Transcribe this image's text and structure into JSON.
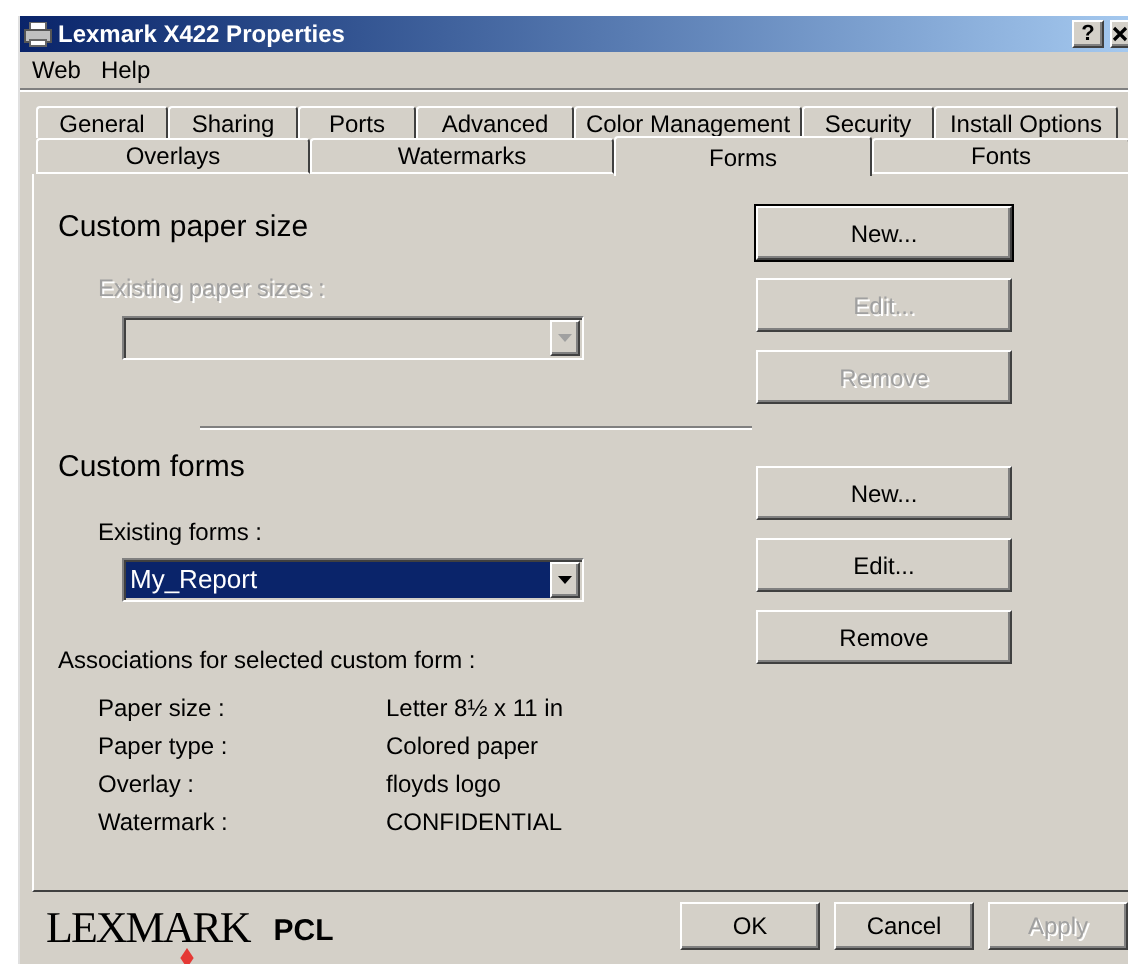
{
  "window": {
    "title": "Lexmark X422 Properties",
    "help_button": "?"
  },
  "menu": [
    {
      "label": "Web"
    },
    {
      "label": "Help"
    }
  ],
  "tabs_row1": [
    {
      "label": "General",
      "selected": false
    },
    {
      "label": "Sharing",
      "selected": false
    },
    {
      "label": "Ports",
      "selected": false
    },
    {
      "label": "Advanced",
      "selected": false
    },
    {
      "label": "Color Management",
      "selected": false
    },
    {
      "label": "Security",
      "selected": false
    },
    {
      "label": "Install Options",
      "selected": false
    }
  ],
  "tabs_row2": [
    {
      "label": "Overlays",
      "selected": false
    },
    {
      "label": "Watermarks",
      "selected": false
    },
    {
      "label": "Forms",
      "selected": true
    },
    {
      "label": "Fonts",
      "selected": false
    }
  ],
  "custom_paper_size": {
    "heading": "Custom paper size",
    "existing_label": "Existing paper sizes :",
    "disabled": true,
    "buttons": [
      {
        "label": "New...",
        "disabled": false,
        "default": true
      },
      {
        "label": "Edit...",
        "disabled": true,
        "default": false
      },
      {
        "label": "Remove",
        "disabled": true,
        "default": false
      }
    ]
  },
  "custom_forms": {
    "heading": "Custom forms",
    "existing_label": "Existing forms :",
    "disabled": false,
    "combo": {
      "value": "My_Report",
      "selected": true
    },
    "buttons": [
      {
        "label": "New...",
        "disabled": false,
        "default": false
      },
      {
        "label": "Edit...",
        "disabled": false,
        "default": false
      },
      {
        "label": "Remove",
        "disabled": false,
        "default": false
      }
    ]
  },
  "associations": {
    "heading": "Associations for selected custom form :",
    "rows": [
      {
        "label": "Paper size :",
        "value": "Letter 8½ x 11 in"
      },
      {
        "label": "Paper type :",
        "value": "Colored paper"
      },
      {
        "label": "Overlay :",
        "value": "floyds logo"
      },
      {
        "label": "Watermark :",
        "value": "CONFIDENTIAL"
      }
    ]
  },
  "footer": {
    "brand": "LEXMARK",
    "suffix": "PCL",
    "buttons": [
      {
        "label": "OK",
        "disabled": false
      },
      {
        "label": "Cancel",
        "disabled": false
      },
      {
        "label": "Apply",
        "disabled": true
      }
    ]
  }
}
